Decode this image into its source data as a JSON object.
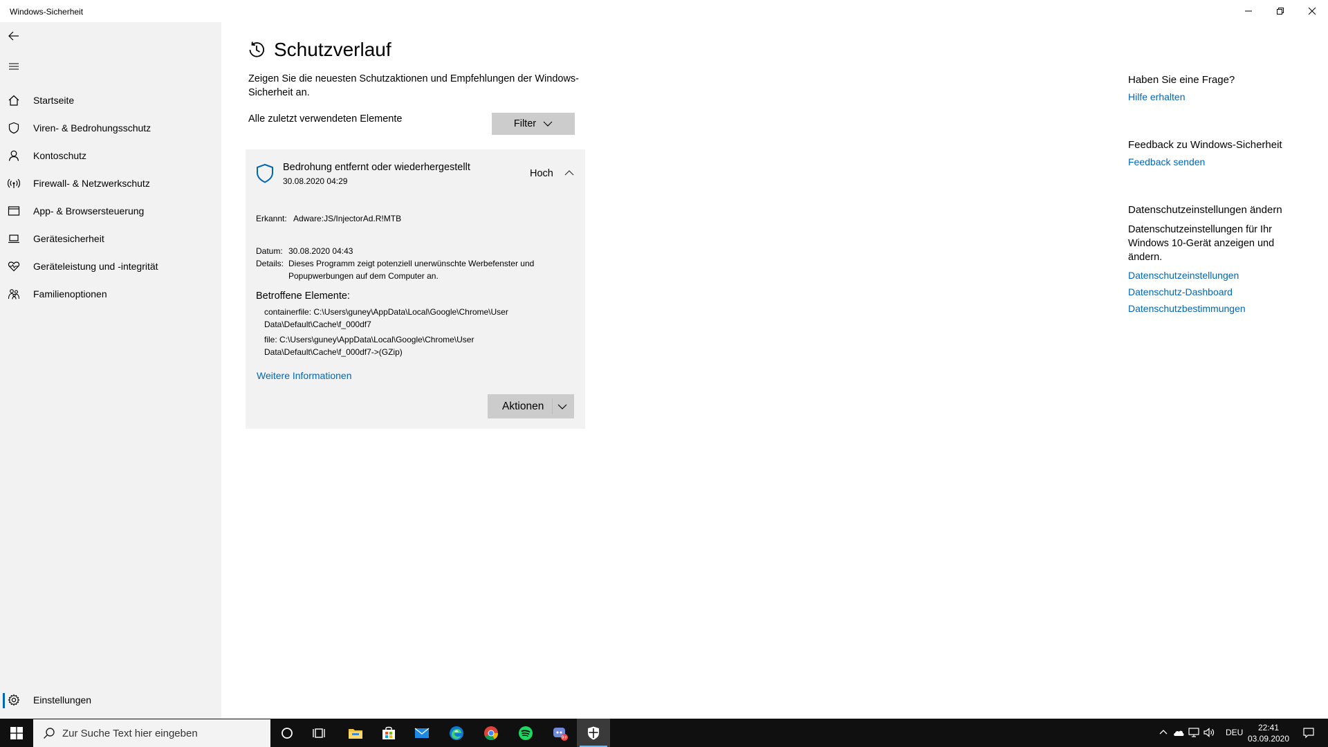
{
  "window": {
    "title": "Windows-Sicherheit",
    "controls": [
      "minimize-icon",
      "restore-icon",
      "close-icon"
    ]
  },
  "sidebar": {
    "items": [
      {
        "label": "Startseite",
        "icon": "home-icon"
      },
      {
        "label": "Viren- & Bedrohungsschutz",
        "icon": "shield-icon"
      },
      {
        "label": "Kontoschutz",
        "icon": "person-icon"
      },
      {
        "label": "Firewall- & Netzwerkschutz",
        "icon": "wireless-icon"
      },
      {
        "label": "App- & Browsersteuerung",
        "icon": "app-window-icon"
      },
      {
        "label": "Gerätesicherheit",
        "icon": "laptop-icon"
      },
      {
        "label": "Geräteleistung und -integrität",
        "icon": "heart-icon"
      },
      {
        "label": "Familienoptionen",
        "icon": "family-icon"
      }
    ],
    "settings_label": "Einstellungen"
  },
  "main": {
    "title": "Schutzverlauf",
    "description": "Zeigen Sie die neuesten Schutzaktionen und Empfehlungen der Windows-Sicherheit an.",
    "filter_label": "Alle zuletzt verwendeten Elemente",
    "filter_button": "Filter",
    "card": {
      "title": "Bedrohung entfernt oder wiederhergestellt",
      "date": "30.08.2020 04:29",
      "severity": "Hoch",
      "detected_label": "Erkannt:",
      "detected_value": "Adware:JS/InjectorAd.R!MTB",
      "date_label": "Datum:",
      "date_value": "30.08.2020 04:43",
      "details_label": "Details:",
      "details_value": "Dieses Programm zeigt potenziell unerwünschte Werbefenster und Popupwerbungen auf dem Computer an.",
      "affected_title": "Betroffene Elemente:",
      "affected_items": [
        "containerfile: C:\\Users\\guney\\AppData\\Local\\Google\\Chrome\\User Data\\Default\\Cache\\f_000df7",
        "file: C:\\Users\\guney\\AppData\\Local\\Google\\Chrome\\User Data\\Default\\Cache\\f_000df7->(GZip)"
      ],
      "more_info": "Weitere Informationen",
      "actions_button": "Aktionen"
    }
  },
  "rail": {
    "question_head": "Haben Sie eine Frage?",
    "help_link": "Hilfe erhalten",
    "feedback_head": "Feedback zu Windows-Sicherheit",
    "feedback_link": "Feedback senden",
    "privacy_head": "Datenschutzeinstellungen ändern",
    "privacy_text": "Datenschutzeinstellungen für Ihr Windows 10-Gerät anzeigen und ändern.",
    "privacy_links": [
      "Datenschutzeinstellungen",
      "Datenschutz-Dashboard",
      "Datenschutzbestimmungen"
    ]
  },
  "taskbar": {
    "search_placeholder": "Zur Suche Text hier eingeben",
    "apps": [
      "cortana-icon",
      "task-view-icon",
      "file-explorer-icon",
      "store-icon",
      "mail-icon",
      "edge-icon",
      "chrome-icon",
      "spotify-icon",
      "discord-icon",
      "windows-security-icon"
    ],
    "language": "DEU",
    "time": "22:41",
    "date": "03.09.2020",
    "colors": {
      "accent": "#0067b8",
      "taskbar": "#101010",
      "indicator": "#76b9ed"
    }
  }
}
